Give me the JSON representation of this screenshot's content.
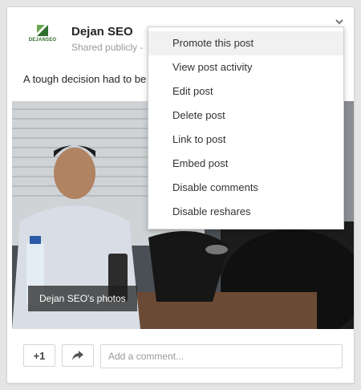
{
  "post": {
    "author": "Dejan SEO",
    "avatar_text": "DEJANSEO",
    "visibility": "Shared publicly",
    "visibility_dash": "-",
    "text": "A tough decision had to be",
    "photo_caption": "Dejan SEO's photos"
  },
  "actions": {
    "plus_one": "+1",
    "share_icon": "share-icon",
    "comment_placeholder": "Add a comment..."
  },
  "menu": {
    "items": [
      "Promote this post",
      "View post activity",
      "Edit post",
      "Delete post",
      "Link to post",
      "Embed post",
      "Disable comments",
      "Disable reshares"
    ],
    "highlighted_index": 0
  },
  "colors": {
    "brand_green": "#2e6f30",
    "menu_highlight": "#f1f1f1",
    "muted_text": "#9a9a9a"
  }
}
